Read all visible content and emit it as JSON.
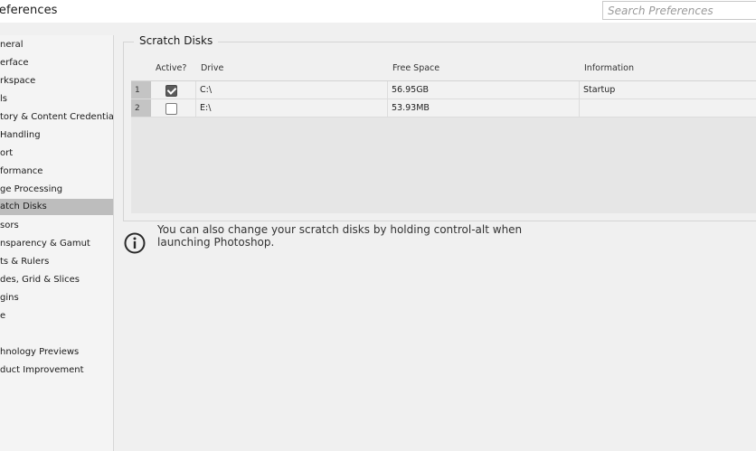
{
  "window": {
    "title": "Preferences"
  },
  "search": {
    "placeholder": "Search Preferences"
  },
  "sidebar": {
    "items": [
      {
        "label": "General",
        "visible_text": "neral"
      },
      {
        "label": "Interface",
        "visible_text": "erface"
      },
      {
        "label": "Workspace",
        "visible_text": "rkspace"
      },
      {
        "label": "Tools",
        "visible_text": "ls"
      },
      {
        "label": "History & Content Credentials",
        "visible_text": "tory & Content Credentials"
      },
      {
        "label": "File Handling",
        "visible_text": "Handling"
      },
      {
        "label": "Export",
        "visible_text": "ort"
      },
      {
        "label": "Performance",
        "visible_text": "formance"
      },
      {
        "label": "Image Processing",
        "visible_text": "ge Processing"
      },
      {
        "label": "Scratch Disks",
        "visible_text": "atch Disks",
        "selected": true
      },
      {
        "label": "Cursors",
        "visible_text": "sors"
      },
      {
        "label": "Transparency & Gamut",
        "visible_text": "nsparency & Gamut"
      },
      {
        "label": "Units & Rulers",
        "visible_text": "ts & Rulers"
      },
      {
        "label": "Guides, Grid & Slices",
        "visible_text": "des, Grid & Slices"
      },
      {
        "label": "Plugins",
        "visible_text": "gins"
      },
      {
        "label": "Type",
        "visible_text": "e"
      },
      {
        "label": "Technology Previews",
        "visible_text": "hnology Previews"
      },
      {
        "label": "Product Improvement",
        "visible_text": "duct Improvement"
      }
    ]
  },
  "scratch_disks": {
    "title": "Scratch Disks",
    "columns": [
      "Active?",
      "Drive",
      "Free Space",
      "Information"
    ],
    "rows": [
      {
        "num": "1",
        "active": true,
        "drive": "C:\\",
        "free_space": "56.95GB",
        "information": "Startup"
      },
      {
        "num": "2",
        "active": false,
        "drive": "E:\\",
        "free_space": "53.93MB",
        "information": ""
      }
    ]
  },
  "info": {
    "icon": "info-circle-icon",
    "text": "You can also change your scratch disks by holding control-alt when launching Photoshop."
  },
  "colors": {
    "background": "#f0f0f0",
    "selected_item": "#bdbdbd",
    "checked_box": "#5a5a5a"
  }
}
